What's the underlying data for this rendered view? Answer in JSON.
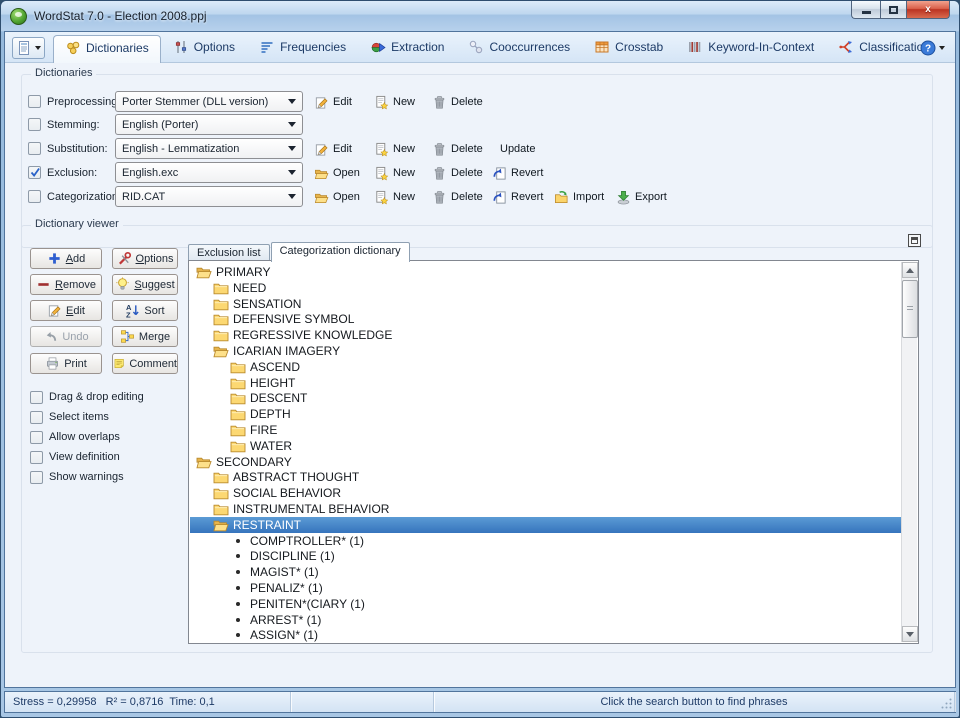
{
  "window": {
    "title": "WordStat 7.0 - Election 2008.ppj",
    "controls": {
      "minimize": "minimize",
      "maximize": "maximize",
      "close": "close"
    }
  },
  "toolbar": {
    "menu_button_icon": "project-menu",
    "help_icon": "help",
    "tabs": [
      {
        "label": "Dictionaries",
        "icon": "dictionaries",
        "active": true
      },
      {
        "label": "Options",
        "icon": "options-tab",
        "active": false
      },
      {
        "label": "Frequencies",
        "icon": "frequencies",
        "active": false
      },
      {
        "label": "Extraction",
        "icon": "extraction",
        "active": false
      },
      {
        "label": "Cooccurrences",
        "icon": "cooccurrences",
        "active": false
      },
      {
        "label": "Crosstab",
        "icon": "crosstab",
        "active": false
      },
      {
        "label": "Keyword-In-Context",
        "icon": "kwic",
        "active": false
      },
      {
        "label": "Classification",
        "icon": "classification",
        "active": false
      }
    ]
  },
  "dictionaries_panel": {
    "title": "Dictionaries",
    "rows": [
      {
        "label": "Preprocessing:",
        "checked": false,
        "value": "Porter Stemmer (DLL version)",
        "actions": [
          {
            "label": "Edit",
            "icon": "edit"
          },
          {
            "label": "New",
            "icon": "new"
          },
          {
            "label": "Delete",
            "icon": "delete"
          }
        ]
      },
      {
        "label": "Stemming:",
        "checked": false,
        "value": "English (Porter)",
        "actions": []
      },
      {
        "label": "Substitution:",
        "checked": false,
        "value": "English - Lemmatization",
        "actions": [
          {
            "label": "Edit",
            "icon": "edit"
          },
          {
            "label": "New",
            "icon": "new"
          },
          {
            "label": "Delete",
            "icon": "delete"
          },
          {
            "label": "Update",
            "icon": null
          }
        ]
      },
      {
        "label": "Exclusion:",
        "checked": true,
        "value": "English.exc",
        "actions": [
          {
            "label": "Open",
            "icon": "open"
          },
          {
            "label": "New",
            "icon": "new"
          },
          {
            "label": "Delete",
            "icon": "delete"
          },
          {
            "label": "Revert",
            "icon": "revert"
          }
        ]
      },
      {
        "label": "Categorization:",
        "checked": false,
        "value": "RID.CAT",
        "actions": [
          {
            "label": "Open",
            "icon": "open"
          },
          {
            "label": "New",
            "icon": "new"
          },
          {
            "label": "Delete",
            "icon": "delete"
          },
          {
            "label": "Revert",
            "icon": "revert"
          },
          {
            "label": "Import",
            "icon": "import"
          },
          {
            "label": "Export",
            "icon": "export"
          }
        ]
      }
    ]
  },
  "viewer": {
    "title": "Dictionary viewer",
    "buttons": [
      {
        "label": "Add",
        "icon": "add",
        "hotkey": "A"
      },
      {
        "label": "Options",
        "icon": "options-tool",
        "hotkey": "O"
      },
      {
        "label": "Remove",
        "icon": "remove",
        "hotkey": "R"
      },
      {
        "label": "Suggest",
        "icon": "suggest",
        "hotkey": "S"
      },
      {
        "label": "Edit",
        "icon": "edit",
        "hotkey": "E"
      },
      {
        "label": "Sort",
        "icon": "sort"
      },
      {
        "label": "Undo",
        "icon": "undo",
        "disabled": true
      },
      {
        "label": "Merge",
        "icon": "merge"
      },
      {
        "label": "Print",
        "icon": "print"
      },
      {
        "label": "Comment",
        "icon": "comment"
      }
    ],
    "checkboxes": [
      {
        "label": "Drag & drop editing",
        "checked": false
      },
      {
        "label": "Select items",
        "checked": false
      },
      {
        "label": "Allow overlaps",
        "checked": false
      },
      {
        "label": "View definition",
        "checked": false
      },
      {
        "label": "Show warnings",
        "checked": false
      }
    ],
    "tabs": [
      {
        "label": "Exclusion list",
        "active": false
      },
      {
        "label": "Categorization dictionary",
        "active": true
      }
    ],
    "tree": [
      {
        "level": 0,
        "label": "PRIMARY",
        "icon": "folder-open",
        "selected": false
      },
      {
        "level": 1,
        "label": "NEED",
        "icon": "folder-closed",
        "selected": false
      },
      {
        "level": 1,
        "label": "SENSATION",
        "icon": "folder-closed",
        "selected": false
      },
      {
        "level": 1,
        "label": "DEFENSIVE SYMBOL",
        "icon": "folder-closed",
        "selected": false
      },
      {
        "level": 1,
        "label": "REGRESSIVE KNOWLEDGE",
        "icon": "folder-closed",
        "selected": false
      },
      {
        "level": 1,
        "label": "ICARIAN IMAGERY",
        "icon": "folder-open",
        "selected": false
      },
      {
        "level": 2,
        "label": "ASCEND",
        "icon": "folder-closed",
        "selected": false
      },
      {
        "level": 2,
        "label": "HEIGHT",
        "icon": "folder-closed",
        "selected": false
      },
      {
        "level": 2,
        "label": "DESCENT",
        "icon": "folder-closed",
        "selected": false
      },
      {
        "level": 2,
        "label": "DEPTH",
        "icon": "folder-closed",
        "selected": false
      },
      {
        "level": 2,
        "label": "FIRE",
        "icon": "folder-closed",
        "selected": false
      },
      {
        "level": 2,
        "label": "WATER",
        "icon": "folder-closed",
        "selected": false
      },
      {
        "level": 0,
        "label": "SECONDARY",
        "icon": "folder-open",
        "selected": false
      },
      {
        "level": 1,
        "label": "ABSTRACT THOUGHT",
        "icon": "folder-closed",
        "selected": false
      },
      {
        "level": 1,
        "label": "SOCIAL BEHAVIOR",
        "icon": "folder-closed",
        "selected": false
      },
      {
        "level": 1,
        "label": "INSTRUMENTAL BEHAVIOR",
        "icon": "folder-closed",
        "selected": false
      },
      {
        "level": 1,
        "label": "RESTRAINT",
        "icon": "folder-open",
        "selected": true
      },
      {
        "level": 2,
        "label": "COMPTROLLER* (1)",
        "icon": "bullet",
        "selected": false
      },
      {
        "level": 2,
        "label": "DISCIPLINE (1)",
        "icon": "bullet",
        "selected": false
      },
      {
        "level": 2,
        "label": "MAGIST* (1)",
        "icon": "bullet",
        "selected": false
      },
      {
        "level": 2,
        "label": "PENALIZ* (1)",
        "icon": "bullet",
        "selected": false
      },
      {
        "level": 2,
        "label": "PENITEN*(CIARY (1)",
        "icon": "bullet",
        "selected": false
      },
      {
        "level": 2,
        "label": "ARREST* (1)",
        "icon": "bullet",
        "selected": false
      },
      {
        "level": 2,
        "label": "ASSIGN* (1)",
        "icon": "bullet",
        "selected": false
      }
    ]
  },
  "status_bar": {
    "panels": [
      {
        "text": "Stress = 0,29958   R² = 0,8716  Time: 0,1",
        "align": "left"
      },
      {
        "text": "",
        "align": "left"
      },
      {
        "text": "Click the search button to find phrases",
        "align": "center"
      }
    ]
  },
  "colors": {
    "selection": "#3d7fd0",
    "titlebar": "#bdd6ee",
    "close_button": "#c0392b",
    "folder": "#fcd872"
  }
}
